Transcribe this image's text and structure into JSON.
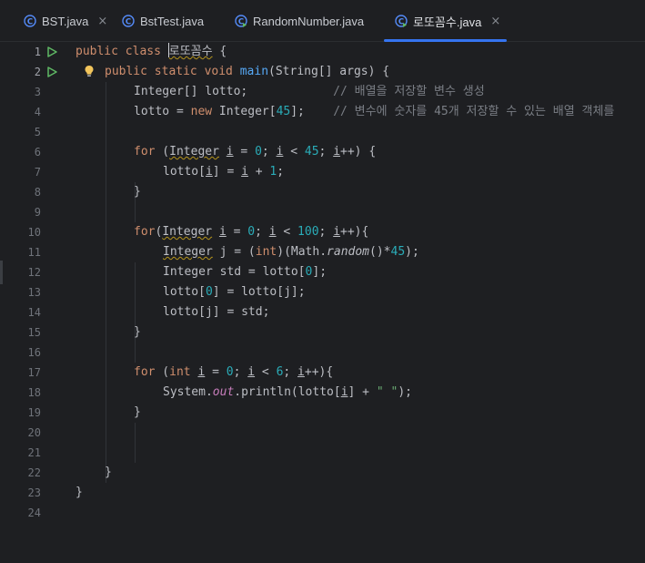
{
  "tabs": [
    {
      "label": "BST.java",
      "icon": "java-class-icon",
      "closable": true,
      "active": false
    },
    {
      "label": "BstTest.java",
      "icon": "java-class-icon",
      "closable": false,
      "active": false
    },
    {
      "label": "RandomNumber.java",
      "icon": "java-class-run-icon",
      "closable": false,
      "active": false
    },
    {
      "label": "로또꼼수.java",
      "icon": "java-class-run-icon",
      "closable": true,
      "active": true
    }
  ],
  "close_glyph": "×",
  "accent_color": "#3574f0",
  "line_numbers": [
    "1",
    "2",
    "3",
    "4",
    "5",
    "6",
    "7",
    "8",
    "9",
    "10",
    "11",
    "12",
    "13",
    "14",
    "15",
    "16",
    "17",
    "18",
    "19",
    "20",
    "21",
    "22",
    "23",
    "24"
  ],
  "code": {
    "l1": {
      "a": "public class ",
      "cls": "로또꼼수",
      "b": " {"
    },
    "l2": {
      "a": "public static void ",
      "fn": "main",
      "b": "(String[] args) {"
    },
    "l3": {
      "code": "Integer[] lotto;            ",
      "comment": "// 배열을 저장할 변수 생성"
    },
    "l4": {
      "a": "lotto = ",
      "kw": "new",
      "b": " Integer[",
      "num": "45",
      "c": "];    ",
      "comment": "// 변수에 숫자를 45개 저장할 수 있는 배열 객체를"
    },
    "l6": {
      "kw": "for",
      "a": " (",
      "type": "Integer",
      "b": " ",
      "v1": "i",
      "c": " = ",
      "n1": "0",
      "d": "; ",
      "v2": "i",
      "e": " < ",
      "n2": "45",
      "f": "; ",
      "v3": "i",
      "g": "++) {"
    },
    "l7": {
      "a": "lotto[",
      "v1": "i",
      "b": "] = ",
      "v2": "i",
      "c": " + ",
      "n1": "1",
      "d": ";"
    },
    "l8": {
      "a": "}"
    },
    "l10": {
      "kw": "for",
      "a": "(",
      "type": "Integer",
      "b": " ",
      "v1": "i",
      "c": " = ",
      "n1": "0",
      "d": "; ",
      "v2": "i",
      "e": " < ",
      "n2": "100",
      "f": "; ",
      "v3": "i",
      "g": "++){"
    },
    "l11": {
      "type": "Integer",
      "a": " j = (",
      "kw": "int",
      "b": ")(Math.",
      "m": "random",
      "c": "()*",
      "n1": "45",
      "d": ");"
    },
    "l12": {
      "a": "Integer std = lotto[",
      "n1": "0",
      "b": "];"
    },
    "l13": {
      "a": "lotto[",
      "n1": "0",
      "b": "] = lotto[j];"
    },
    "l14": {
      "a": "lotto[j] = std;"
    },
    "l15": {
      "a": "}"
    },
    "l17": {
      "kw1": "for",
      "a": " (",
      "kw2": "int",
      "b": " ",
      "v1": "i",
      "c": " = ",
      "n1": "0",
      "d": "; ",
      "v2": "i",
      "e": " < ",
      "n2": "6",
      "f": "; ",
      "v3": "i",
      "g": "++){"
    },
    "l18": {
      "a": "System.",
      "out": "out",
      "b": ".println(lotto[",
      "v1": "i",
      "c": "] + ",
      "s": "\" \"",
      "d": ");"
    },
    "l19": {
      "a": "}"
    },
    "l22": {
      "a": "}"
    },
    "l23": {
      "a": "}"
    }
  }
}
